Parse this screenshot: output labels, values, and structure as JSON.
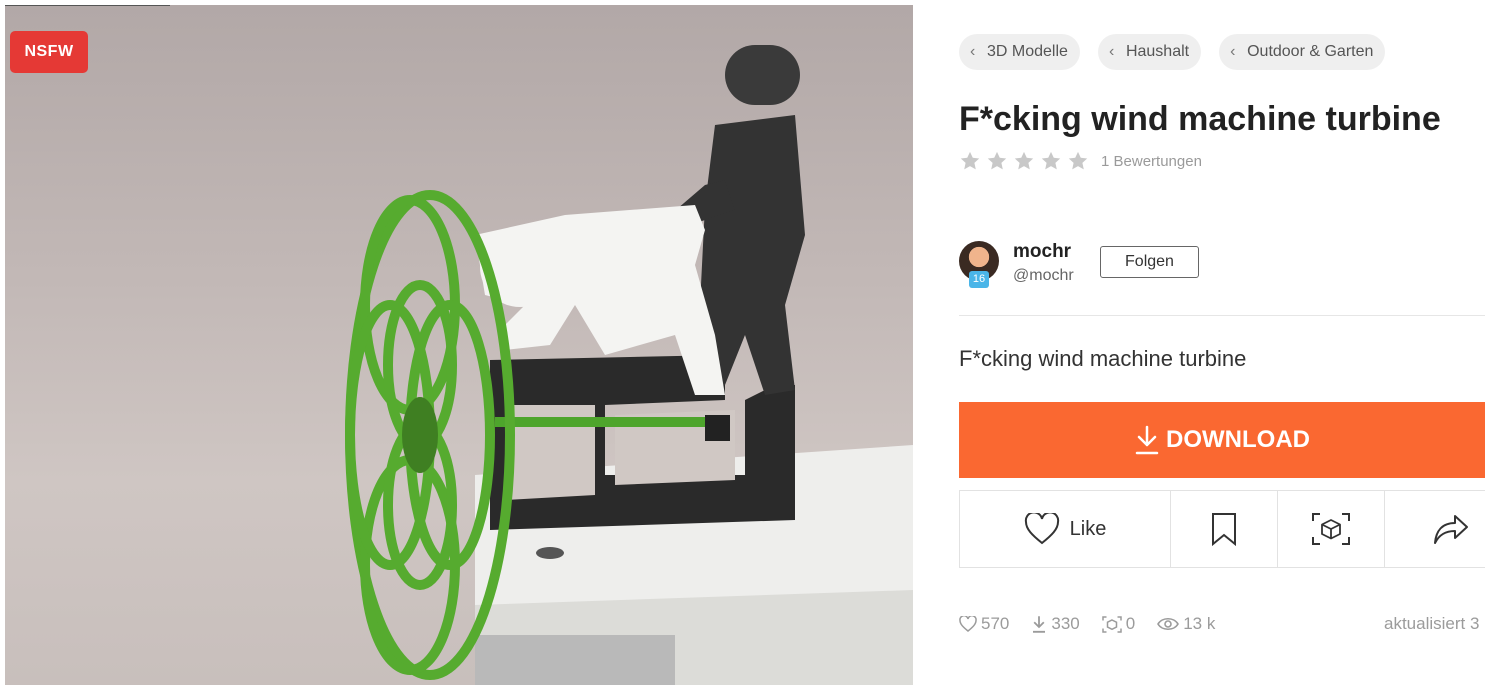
{
  "badge": {
    "nsfw": "NSFW"
  },
  "breadcrumbs": [
    "3D Modelle",
    "Haushalt",
    "Outdoor & Garten"
  ],
  "model": {
    "title": "F*cking wind machine turbine",
    "rating_count": "1 Bewertungen",
    "description": "F*cking wind machine turbine"
  },
  "author": {
    "name": "mochr",
    "handle": "@mochr",
    "level": "16",
    "follow_label": "Folgen"
  },
  "actions": {
    "download_label": "DOWNLOAD",
    "like_label": "Like"
  },
  "stats": {
    "likes": "570",
    "downloads": "330",
    "ar": "0",
    "views": "13 k",
    "updated": "aktualisiert 3"
  },
  "colors": {
    "download": "#fa6831",
    "nsfw": "#e53935",
    "star": "#c8c8c8"
  }
}
